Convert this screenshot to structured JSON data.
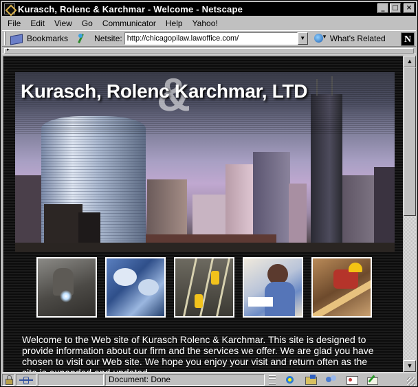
{
  "window": {
    "title": "Kurasch, Rolenc & Karchmar - Welcome - Netscape",
    "minimize": "_",
    "maximize": "□",
    "close": "×"
  },
  "menu": {
    "items": [
      "File",
      "Edit",
      "View",
      "Go",
      "Communicator",
      "Help",
      "Yahoo!"
    ]
  },
  "toolbar": {
    "bookmarks_label": "Bookmarks",
    "netsite_label": "Netsite:",
    "url": "http://chicagopilaw.lawoffice.com/",
    "url_dropdown": "▼",
    "whats_related_label": "What's Related",
    "logo_letter": "N",
    "collapse_arrow": "▸"
  },
  "page": {
    "firm_title": "Kurasch, Rolenc   Karchmar, LTD",
    "ampersand": "&",
    "welcome_text": "Welcome to the Web site of Kurasch Rolenc & Karchmar. This site is designed to provide information about our firm and the services we offer. We are glad you have chosen to visit our Web site. We hope you enjoy your visit and return often as the site is expanded and updated."
  },
  "scrollbar": {
    "up": "▲",
    "down": "▼"
  },
  "status": {
    "text": "Document: Done"
  },
  "icons": {
    "app": "netscape-n-icon",
    "bookmarks": "bookmarks-icon",
    "netsite": "netsite-icon",
    "related": "whats-related-icon",
    "lock": "security-lock-icon",
    "connection": "connection-icon",
    "navigator": "navigator-icon",
    "mail": "mailbox-icon",
    "news": "discussion-groups-icon",
    "address_book": "address-book-icon",
    "composer": "composer-icon"
  }
}
